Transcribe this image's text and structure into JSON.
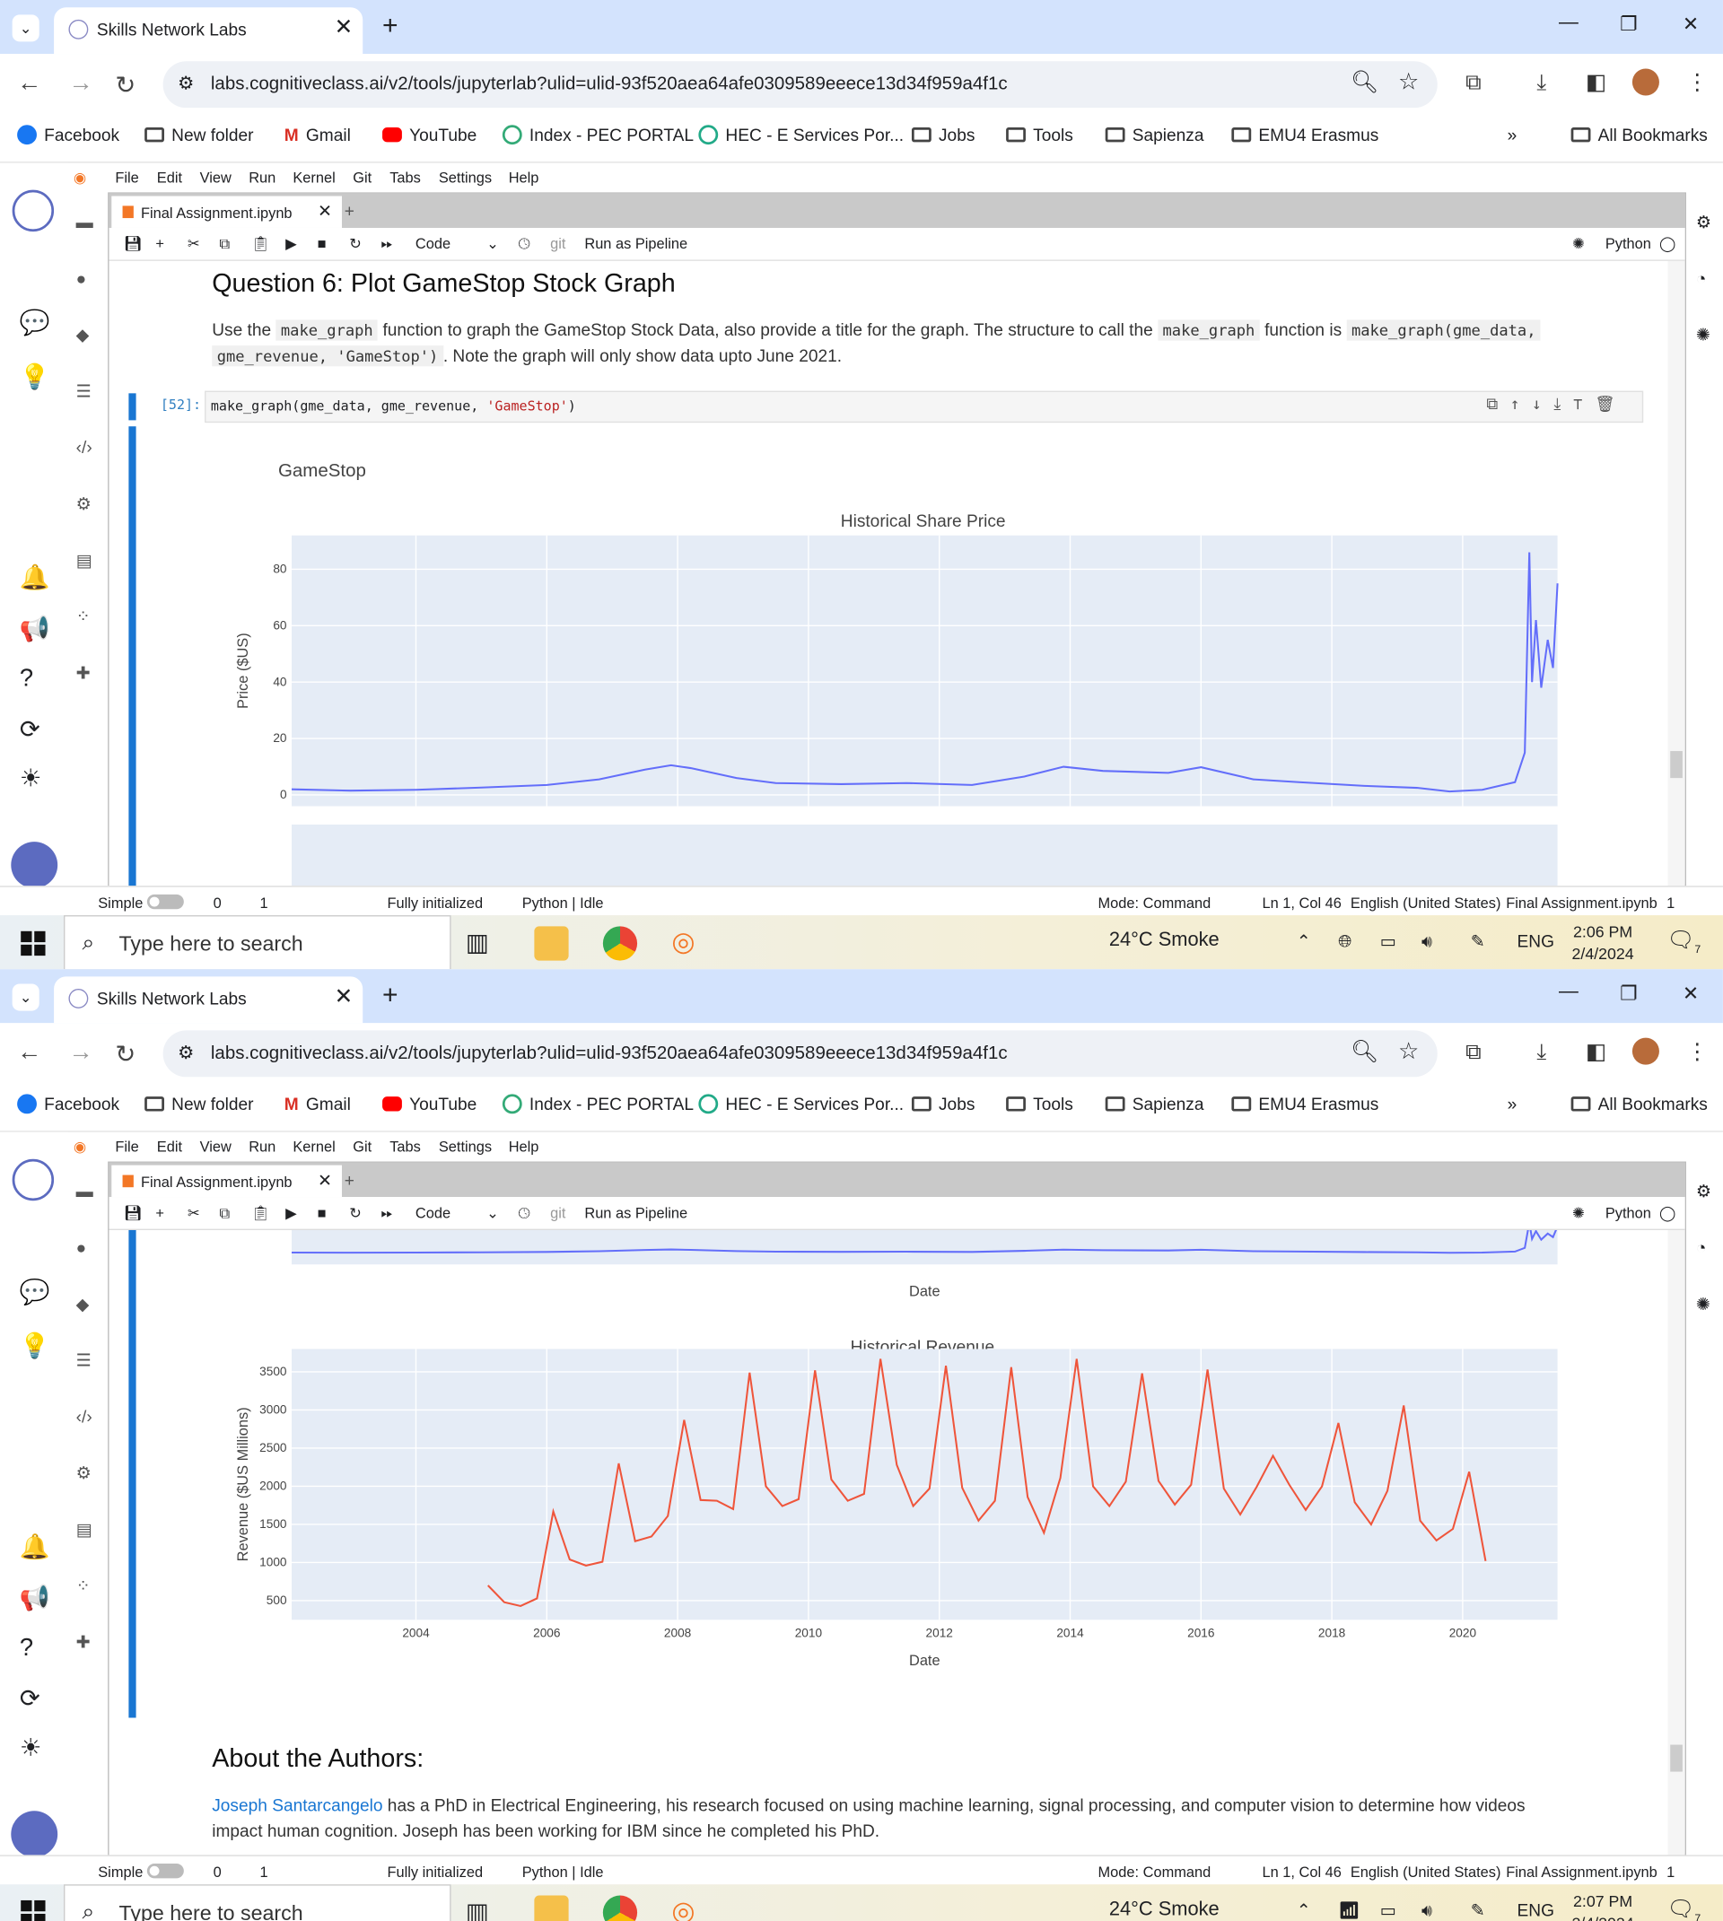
{
  "browser": {
    "tab_title": "Skills Network Labs",
    "url": "labs.cognitiveclass.ai/v2/tools/jupyterlab?ulid=ulid-93f520aea64afe0309589eeece13d34f959a4f1c",
    "bookmarks": [
      "Facebook",
      "New folder",
      "Gmail",
      "YouTube",
      "Index - PEC PORTAL",
      "HEC - E Services Por...",
      "Jobs",
      "Tools",
      "Sapienza",
      "EMU4 Erasmus"
    ],
    "all_bookmarks": "All Bookmarks",
    "overflow": "»"
  },
  "jupyter": {
    "menu": [
      "File",
      "Edit",
      "View",
      "Run",
      "Kernel",
      "Git",
      "Tabs",
      "Settings",
      "Help"
    ],
    "doc_tab": "Final Assignment.ipynb",
    "toolbar": {
      "cell_type": "Code",
      "git": "git",
      "pipeline": "Run as Pipeline",
      "kernel": "Python"
    },
    "status": {
      "mode_toggle": "Simple",
      "zero": "0",
      "one": "1",
      "init": "Fully initialized",
      "kernel": "Python | Idle",
      "mode": "Mode: Command",
      "cursor": "Ln 1, Col 46",
      "lang": "English (United States)",
      "file": "Final Assignment.ipynb",
      "count": "1"
    }
  },
  "notebook": {
    "q6_heading": "Question 6: Plot GameStop Stock Graph",
    "q6_text_a": "Use the",
    "q6_code_a": "make_graph",
    "q6_text_b": "function to graph the GameStop Stock Data, also provide a title for the graph. The structure to call the",
    "q6_code_b": "make_graph",
    "q6_text_c": "function is",
    "q6_code_c": "make_graph(gme_data,",
    "q6_code_d": "gme_revenue, 'GameStop')",
    "q6_text_d": ". Note the graph will only show data upto June 2021.",
    "prompt": "[52]:",
    "code_prefix": "make_graph(gme_data, gme_revenue, ",
    "code_string": "'GameStop'",
    "code_suffix": ")",
    "plot_title": "GameStop",
    "about_heading": "About the Authors:",
    "author_name": "Joseph Santarcangelo",
    "author_text": "has a PhD in Electrical Engineering, his research focused on using machine learning, signal processing, and computer vision to determine how videos impact human cognition. Joseph has been working for IBM since he completed his PhD."
  },
  "taskbar": {
    "search_placeholder": "Type here to search",
    "weather": "24°C  Smoke",
    "lang": "ENG",
    "time1": "2:06 PM",
    "date1": "2/4/2024",
    "time2": "2:07 PM",
    "date2": "2/4/2024",
    "notif_count": "7"
  },
  "chart_data": [
    {
      "type": "line",
      "title": "Historical Share Price",
      "xlabel": "Date",
      "ylabel": "Price ($US)",
      "ylim": [
        -4,
        92
      ],
      "yticks": [
        0,
        20,
        40,
        60,
        80
      ],
      "xlim": [
        2002.1,
        2021.45
      ],
      "color": "#636efa",
      "series": [
        {
          "x": [
            2002.1,
            2003.0,
            2004.0,
            2005.0,
            2006.0,
            2006.8,
            2007.5,
            2007.9,
            2008.2,
            2008.9,
            2009.5,
            2010.5,
            2011.5,
            2012.5,
            2013.3,
            2013.9,
            2014.5,
            2015.5,
            2016.0,
            2016.8,
            2017.5,
            2018.5,
            2019.3,
            2019.8,
            2020.3,
            2020.8,
            2020.95,
            2021.02,
            2021.06,
            2021.12,
            2021.2,
            2021.3,
            2021.38,
            2021.45
          ],
          "y": [
            2,
            1.5,
            1.8,
            2.6,
            3.5,
            5.5,
            9,
            10.5,
            9.5,
            6,
            4.2,
            3.8,
            4.2,
            3.5,
            6.5,
            10,
            8.5,
            7.8,
            9.8,
            5.5,
            4.5,
            3.2,
            2.5,
            1.2,
            1.8,
            4.5,
            15,
            86,
            40,
            62,
            38,
            55,
            45,
            75
          ]
        }
      ]
    },
    {
      "type": "line",
      "title": "Historical Revenue",
      "xlabel": "Date",
      "ylabel": "Revenue ($US Millions)",
      "ylim": [
        250,
        3800
      ],
      "yticks": [
        500,
        1000,
        1500,
        2000,
        2500,
        3000,
        3500
      ],
      "xticks": [
        2004,
        2006,
        2008,
        2010,
        2012,
        2014,
        2016,
        2018,
        2020
      ],
      "xlim": [
        2002.1,
        2021.45
      ],
      "color": "#ef553b",
      "series": [
        {
          "x": [
            2005.1,
            2005.35,
            2005.6,
            2005.85,
            2006.1,
            2006.35,
            2006.6,
            2006.85,
            2007.1,
            2007.35,
            2007.6,
            2007.85,
            2008.1,
            2008.35,
            2008.6,
            2008.85,
            2009.1,
            2009.35,
            2009.6,
            2009.85,
            2010.1,
            2010.35,
            2010.6,
            2010.85,
            2011.1,
            2011.35,
            2011.6,
            2011.85,
            2012.1,
            2012.35,
            2012.6,
            2012.85,
            2013.1,
            2013.35,
            2013.6,
            2013.85,
            2014.1,
            2014.35,
            2014.6,
            2014.85,
            2015.1,
            2015.35,
            2015.6,
            2015.85,
            2016.1,
            2016.35,
            2016.6,
            2016.85,
            2017.1,
            2017.35,
            2017.6,
            2017.85,
            2018.1,
            2018.35,
            2018.6,
            2018.85,
            2019.1,
            2019.35,
            2019.6,
            2019.85,
            2020.1,
            2020.35
          ],
          "y": [
            700,
            480,
            430,
            530,
            1670,
            1040,
            960,
            1010,
            2300,
            1280,
            1340,
            1610,
            2870,
            1820,
            1810,
            1700,
            3490,
            2000,
            1740,
            1830,
            3520,
            2090,
            1810,
            1900,
            3670,
            2280,
            1740,
            1970,
            3580,
            1980,
            1550,
            1810,
            3560,
            1860,
            1390,
            2110,
            3670,
            2000,
            1740,
            2060,
            3480,
            2070,
            1760,
            2020,
            3530,
            1970,
            1630,
            1990,
            2400,
            2020,
            1690,
            2000,
            2830,
            1790,
            1500,
            1940,
            3060,
            1550,
            1290,
            1440,
            2190,
            1020
          ]
        }
      ]
    }
  ]
}
